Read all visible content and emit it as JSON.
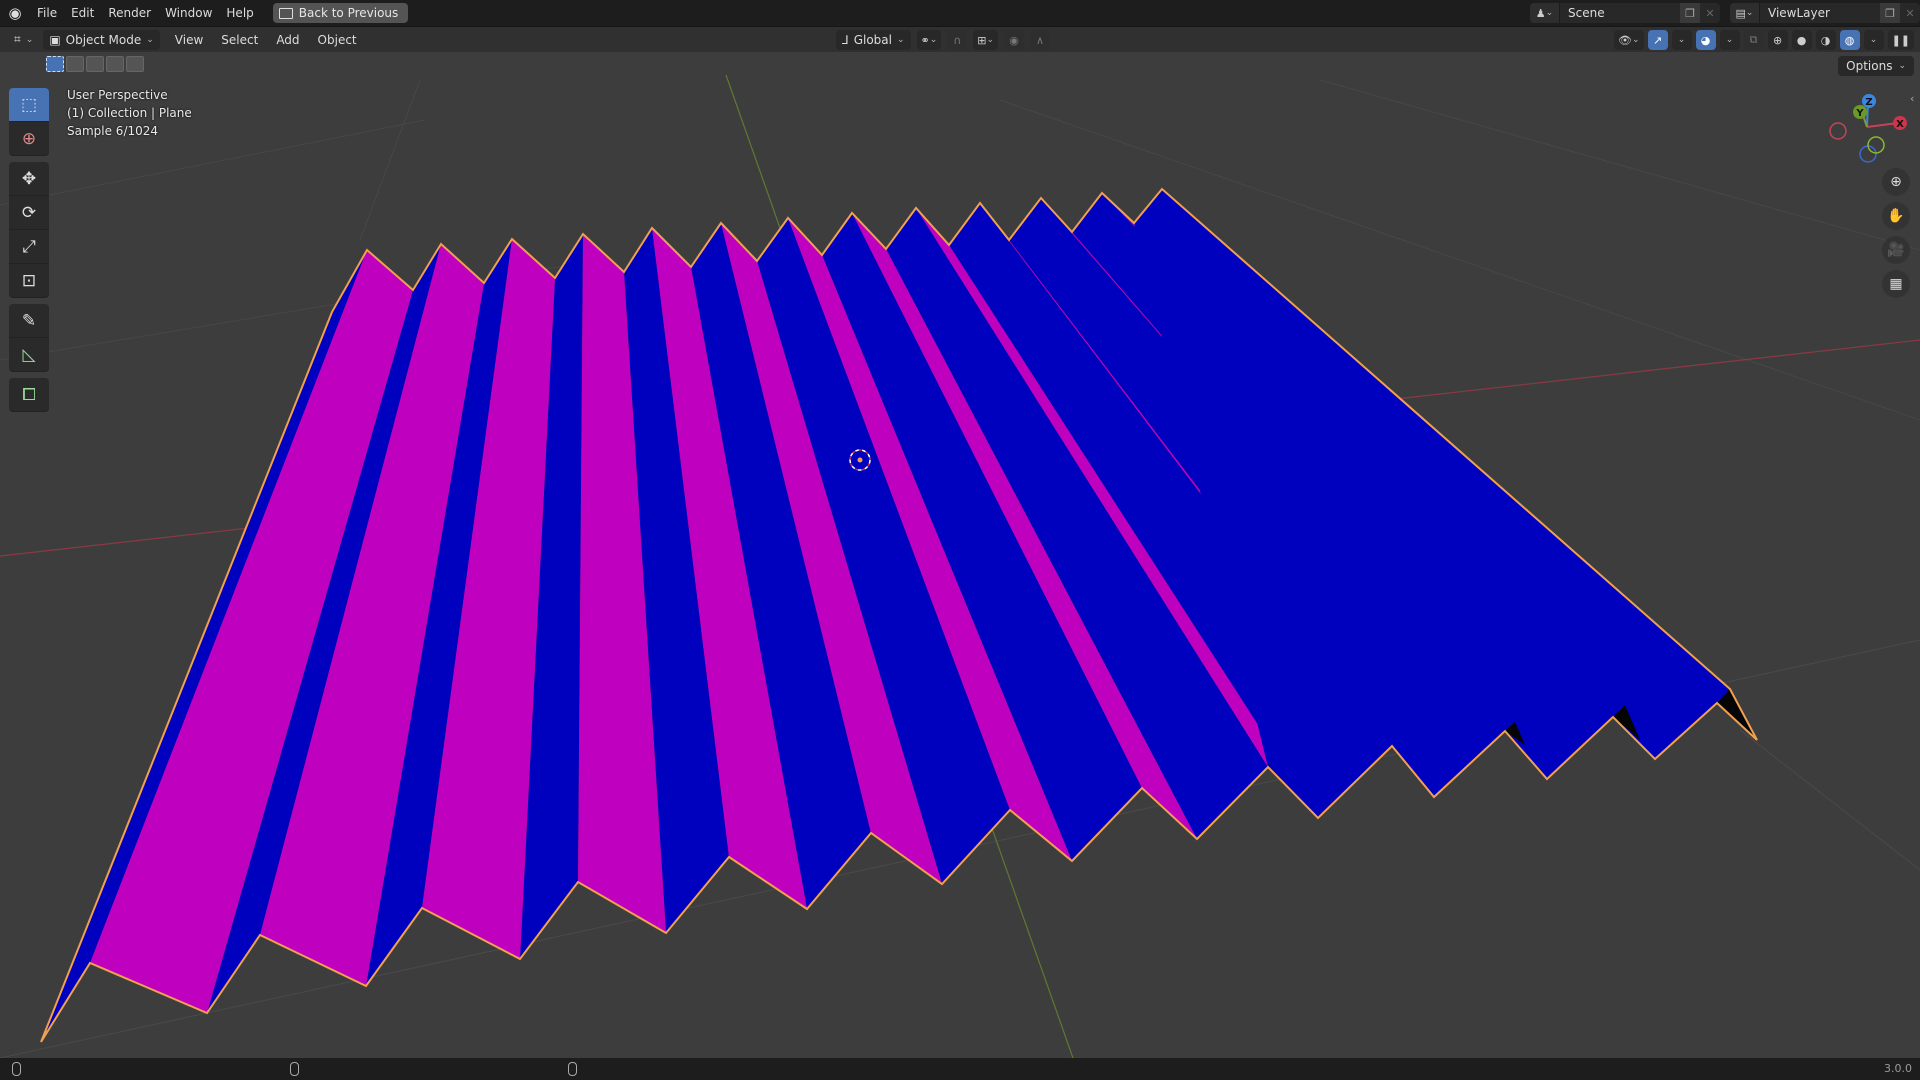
{
  "topbar": {
    "app_icon": "blender-logo-icon",
    "menus": [
      "File",
      "Edit",
      "Render",
      "Window",
      "Help"
    ],
    "back_button": "Back to Previous",
    "scene": {
      "icon": "scene-icon",
      "name": "Scene"
    },
    "view_layer": {
      "icon": "view-layer-icon",
      "name": "ViewLayer"
    }
  },
  "header": {
    "editor_type_icon": "3d-viewport-icon",
    "mode": "Object Mode",
    "menus": [
      "View",
      "Select",
      "Add",
      "Object"
    ],
    "transform_orientation": "Global",
    "pivot_icon": "pivot-icon",
    "snap_icon": "magnet-icon",
    "snap_target_icon": "snap-increment-icon",
    "proportional_icon": "proportional-edit-icon",
    "falloff_icon": "falloff-curve-icon",
    "options": "Options"
  },
  "viewport": {
    "overlay": [
      "User Perspective",
      "(1) Collection | Plane",
      "Sample 6/1024"
    ],
    "gizmo_axes": [
      "X",
      "Y",
      "Z"
    ],
    "colors": {
      "background": "#3d3d3d",
      "face_a": "#c000bf",
      "face_b": "#0000bf",
      "outline": "#f0a050",
      "x_axis": "#c44456",
      "y_axis": "#7a9a3a"
    }
  },
  "tools": [
    {
      "name": "select-box-tool",
      "icon": "select-box-icon",
      "active": true
    },
    {
      "name": "cursor-tool",
      "icon": "cursor-icon",
      "active": false
    },
    {
      "name": "move-tool",
      "icon": "move-icon",
      "active": false
    },
    {
      "name": "rotate-tool",
      "icon": "rotate-icon",
      "active": false
    },
    {
      "name": "scale-tool",
      "icon": "scale-icon",
      "active": false
    },
    {
      "name": "transform-tool",
      "icon": "transform-icon",
      "active": false
    },
    {
      "name": "annotate-tool",
      "icon": "annotate-icon",
      "active": false
    },
    {
      "name": "measure-tool",
      "icon": "measure-icon",
      "active": false
    },
    {
      "name": "add-cube-tool",
      "icon": "add-cube-icon",
      "active": false
    }
  ],
  "nav_buttons": [
    "zoom-icon",
    "hand-pan-icon",
    "camera-icon",
    "grid-ortho-icon"
  ],
  "status": {
    "version": "3.0.0"
  }
}
